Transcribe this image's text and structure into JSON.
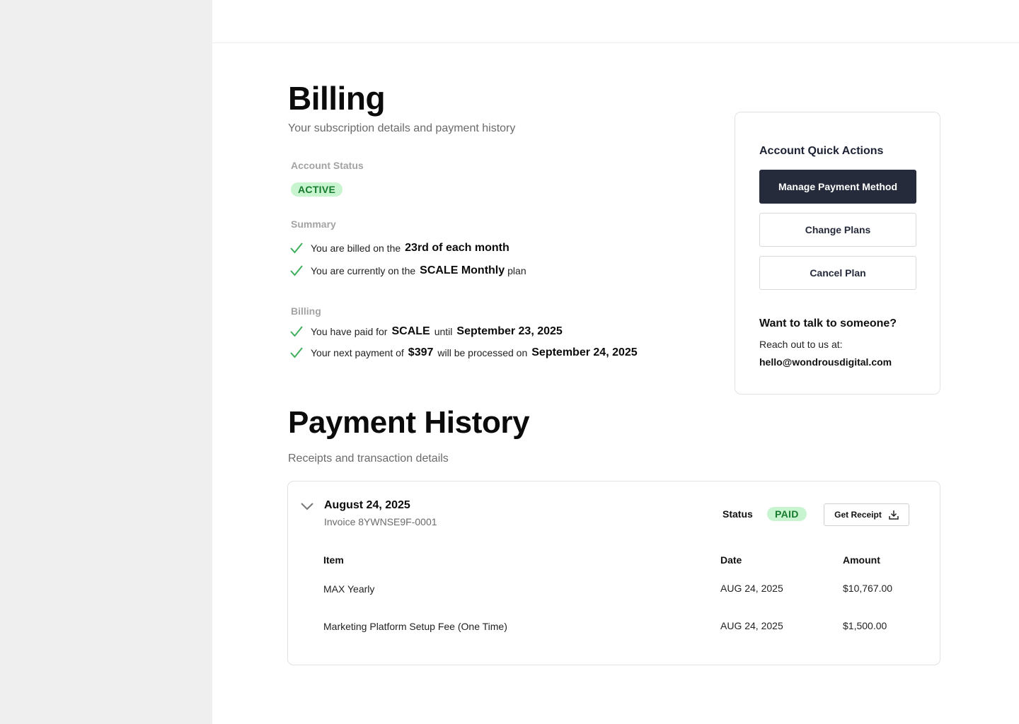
{
  "billing": {
    "title": "Billing",
    "subtitle": "Your subscription details and payment history",
    "account_status_label": "Account Status",
    "account_status": "ACTIVE",
    "summary_label": "Summary",
    "summary": {
      "billed_prefix": "You are billed on the",
      "billed_day": "23rd of each month",
      "plan_prefix": "You are currently on the",
      "plan_name": "SCALE Monthly",
      "plan_suffix": "plan"
    },
    "billing_label": "Billing",
    "details": {
      "paid_prefix": "You have paid for",
      "paid_plan": "SCALE",
      "paid_mid": "until",
      "paid_until": "September 23, 2025",
      "next_prefix": "Your next payment of",
      "next_amount": "$397",
      "next_mid": "will be processed on",
      "next_date": "September 24, 2025"
    }
  },
  "quick_actions": {
    "title": "Account Quick Actions",
    "manage_payment": "Manage Payment Method",
    "change_plans": "Change Plans",
    "cancel_plan": "Cancel Plan",
    "talk_title": "Want to talk to someone?",
    "talk_text": "Reach out to us at:",
    "email": "hello@wondrousdigital.com"
  },
  "history": {
    "title": "Payment History",
    "subtitle": "Receipts and transaction details",
    "invoice": {
      "date": "August 24, 2025",
      "number": "Invoice 8YWNSE9F-0001",
      "status_label": "Status",
      "status": "PAID",
      "receipt_button": "Get Receipt",
      "columns": {
        "item": "Item",
        "date": "Date",
        "amount": "Amount"
      },
      "rows": [
        {
          "item": "MAX Yearly",
          "date": "AUG 24, 2025",
          "amount": "$10,767.00"
        },
        {
          "item": "Marketing Platform Setup Fee (One Time)",
          "date": "AUG 24, 2025",
          "amount": "$1,500.00"
        }
      ]
    }
  },
  "colors": {
    "sidebar_bg": "#efefef",
    "primary_button": "#262b3b",
    "badge_bg": "#c8f5cf",
    "badge_text": "#167a2c",
    "check": "#3fae5a"
  },
  "icons": {
    "check": "check-icon",
    "chevron": "chevron-down-icon",
    "download": "download-icon"
  }
}
